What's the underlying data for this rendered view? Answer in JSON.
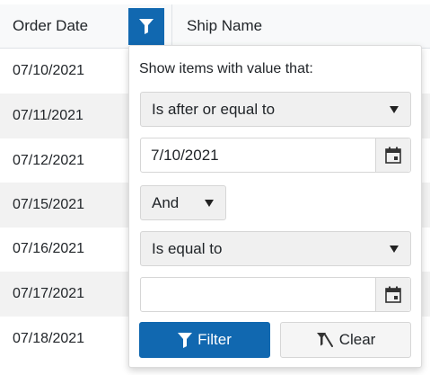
{
  "grid": {
    "columns": {
      "order_date": "Order Date",
      "ship_name": "Ship Name"
    },
    "rows": [
      "07/10/2021",
      "07/11/2021",
      "07/12/2021",
      "07/15/2021",
      "07/16/2021",
      "07/17/2021",
      "07/18/2021"
    ]
  },
  "filter_popup": {
    "title": "Show items with value that:",
    "first_operator": "Is after or equal to",
    "first_value": "7/10/2021",
    "logic": "And",
    "second_operator": "Is equal to",
    "second_value": "",
    "filter_label": "Filter",
    "clear_label": "Clear"
  },
  "icons": {
    "header_filter": "filter-icon",
    "calendar": "calendar-icon",
    "filter_button": "filter-icon",
    "clear_button": "filter-clear-icon"
  },
  "colors": {
    "accent": "#1168b0",
    "row_alt": "#f2f2f2",
    "header_bg": "#f8f9fa"
  }
}
